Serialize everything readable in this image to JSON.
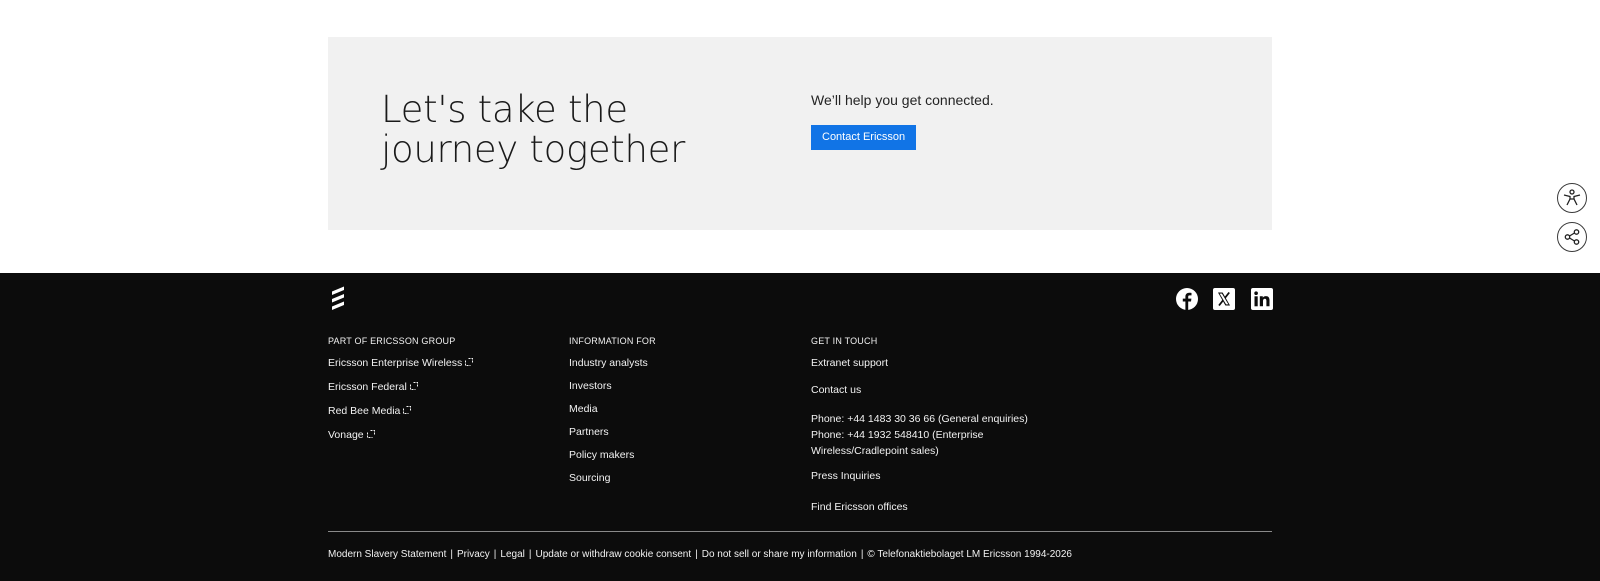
{
  "cta": {
    "title": "Let's take the journey together",
    "subtitle": "We’ll help you get connected.",
    "button_label": "Contact Ericsson"
  },
  "floating": {
    "accessibility_icon": "accessibility-icon",
    "share_icon": "share-icon"
  },
  "footer": {
    "logo_icon": "ericsson-logo-icon",
    "social": [
      "facebook-icon",
      "x-icon",
      "linkedin-icon"
    ],
    "group": {
      "heading": "PART OF ERICSSON GROUP",
      "links": [
        "Ericsson Enterprise Wireless",
        "Ericsson Federal",
        "Red Bee Media",
        "Vonage"
      ]
    },
    "info": {
      "heading": "INFORMATION FOR",
      "links": [
        "Industry analysts",
        "Investors",
        "Media",
        "Partners",
        "Policy makers",
        "Sourcing"
      ]
    },
    "contact": {
      "heading": "GET IN TOUCH",
      "extranet": "Extranet support",
      "contact_us": "Contact us",
      "phone_1": "Phone: +44 1483 30 36 66 (General enquiries)",
      "phone_2": "Phone: +44 1932 548410 (Enterprise Wireless/Cradlepoint sales)",
      "press": "Press Inquiries",
      "offices": "Find Ericsson offices"
    },
    "legal": {
      "links": [
        "Modern Slavery Statement",
        "Privacy",
        "Legal",
        "Update or withdraw cookie consent",
        "Do not sell or share my information"
      ],
      "separator": "|",
      "copyright": "© Telefonaktiebolaget LM Ericsson 1994-2026"
    }
  },
  "colors": {
    "accent": "#1174e6",
    "footer_bg": "#0c0c0c",
    "cta_bg": "#f1f1f1"
  }
}
